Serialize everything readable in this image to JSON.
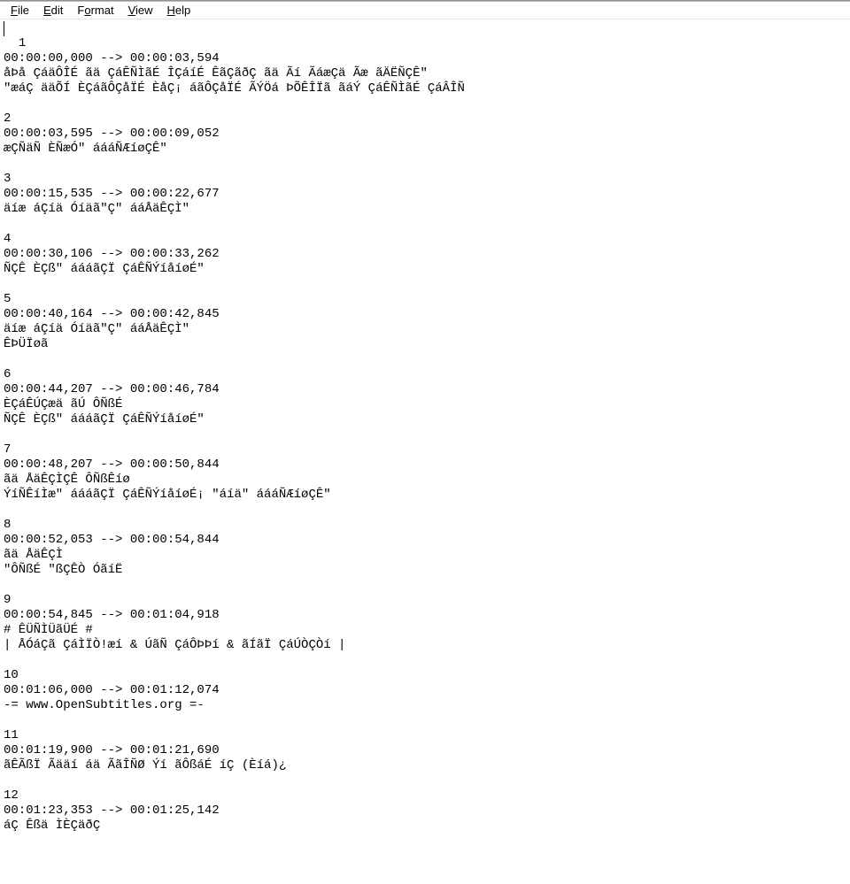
{
  "menu": {
    "file": {
      "pre": "",
      "u": "F",
      "post": "ile"
    },
    "edit": {
      "pre": "",
      "u": "E",
      "post": "dit"
    },
    "format": {
      "pre": "F",
      "u": "o",
      "post": "rmat"
    },
    "view": {
      "pre": "",
      "u": "V",
      "post": "iew"
    },
    "help": {
      "pre": "",
      "u": "H",
      "post": "elp"
    }
  },
  "editor": {
    "text": "1\n00:00:00,000 --> 00:00:03,594\nåÞå ÇáäÔÎÉ ãä ÇáÊÑÌãÉ ÎÇáíÉ ÊãÇãðÇ ãä Ãí ÃáæÇä Ãæ ãÄËÑÇÊ\"\n\"æáÇ ääÕÍ ÈÇáãÔÇåÏÉ ÈåÇ¡ áãÔÇåÏÉ ÃÝÖá ÞÕÊÎÏã ãáÝ ÇáÊÑÌãÉ ÇáÂÎÑ\n\n2\n00:00:03,595 --> 00:00:09,052\næÇÑäÑ ÈÑæÓ\" áááÑÆíøÇÊ\"\n\n3\n00:00:15,535 --> 00:00:22,677\näíæ áÇíä Óíäã\"Ç\" ááÅäÊÇÌ\"\n\n4\n00:00:30,106 --> 00:00:33,262\nÑÇÊ ÈÇß\" áááãÇÏ ÇáÊÑÝíåíøÉ\"\n\n5\n00:00:40,164 --> 00:00:42,845\näíæ áÇíä Óíäã\"Ç\" ááÅäÊÇÌ\"\nÊÞÜÏøã\n\n6\n00:00:44,207 --> 00:00:46,784\nÈÇáÊÚÇæä ãÚ ÔÑßÉ\nÑÇÊ ÈÇß\" áááãÇÏ ÇáÊÑÝíåíøÉ\"\n\n7\n00:00:48,207 --> 00:00:50,844\nãä ÅäÊÇÌÇÊ ÔÑßÊíø\nÝíÑÊíÌæ\" áááãÇÏ ÇáÊÑÝíåíøÉ¡ \"áíä\" áááÑÆíøÇÊ\"\n\n8\n00:00:52,053 --> 00:00:54,844\nãä ÅäÊÇÌ\n\"ÔÑßÉ \"ßÇÊÒ ÓãíË\n\n9\n00:00:54,845 --> 00:01:04,918\n# ÊÜÑÌÜãÜÉ #\n| ÅÓáÇã ÇáÌÏÒ!æí & ÚãÑ ÇáÔÞÞí & ãÍãÏ ÇáÚÒÇÒí |\n\n10\n00:01:06,000 --> 00:01:12,074\n-= www.OpenSubtitles.org =-\n\n11\n00:01:19,900 --> 00:01:21,690\nãÊÃßÏ Ãääí áä ÃãÎÑØ Ýí ãÔßáÉ íÇ (Èíá)¿\n\n12\n00:01:23,353 --> 00:01:25,142\náÇ Êßä ÌÈÇäðÇ"
  }
}
